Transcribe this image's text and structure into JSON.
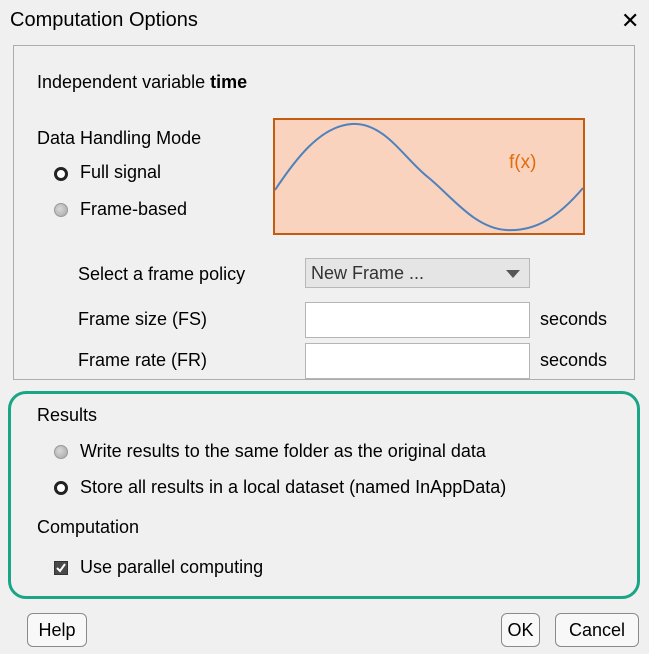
{
  "window": {
    "title": "Computation Options",
    "close_glyph": "✕"
  },
  "independent_variable": {
    "label": "Independent variable",
    "value": "time"
  },
  "data_handling": {
    "heading": "Data Handling Mode",
    "options": [
      {
        "label": "Full signal",
        "selected": true,
        "enabled": true
      },
      {
        "label": "Frame-based",
        "selected": false,
        "enabled": false
      }
    ],
    "preview_label": "f(x)"
  },
  "frame": {
    "policy_label": "Select a frame policy",
    "policy_value": "New Frame ...",
    "size_label": "Frame size (FS)",
    "size_value": "",
    "size_unit": "seconds",
    "rate_label": "Frame rate (FR)",
    "rate_value": "",
    "rate_unit": "seconds"
  },
  "results": {
    "heading": "Results",
    "options": [
      {
        "label": "Write results to the same folder as the original data",
        "selected": false,
        "enabled": false
      },
      {
        "label": "Store all results in a local dataset (named InAppData)",
        "selected": true,
        "enabled": true
      }
    ]
  },
  "computation": {
    "heading": "Computation",
    "parallel_label": "Use parallel computing",
    "parallel_checked": true
  },
  "buttons": {
    "help": "Help",
    "ok": "OK",
    "cancel": "Cancel"
  },
  "colors": {
    "highlight": "#1aa586",
    "preview_fill": "#f9d3bd",
    "preview_border": "#c55a11",
    "curve": "#4f81bd",
    "fx_text": "#e26b0a"
  }
}
